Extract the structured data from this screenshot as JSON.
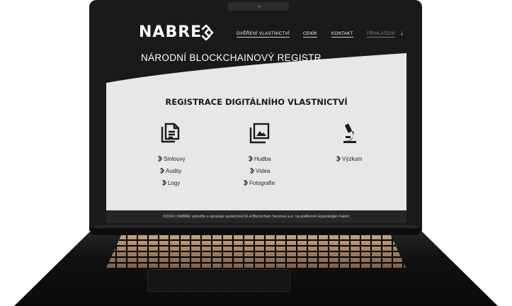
{
  "brand": {
    "logo_text": "NABRE",
    "registry_title": "NÁRODNÍ BLOCKCHAINOVÝ REGISTR"
  },
  "nav": {
    "items": [
      {
        "label": "OVĚŘENÍ VLASTNICTVÍ"
      },
      {
        "label": "CENÍK"
      },
      {
        "label": "KONTAKT"
      },
      {
        "label": "PŘIHLÁŠENÍ"
      }
    ],
    "login_arrow": "↓"
  },
  "main": {
    "title": "REGISTRACE DIGITÁLNÍHO VLASTNICTVÍ",
    "categories": [
      {
        "icon": "documents-icon",
        "items": [
          "Smlouvy",
          "Audity",
          "Logy"
        ]
      },
      {
        "icon": "images-icon",
        "items": [
          "Hudba",
          "Videa",
          "Fotografie"
        ]
      },
      {
        "icon": "microscope-icon",
        "items": [
          "Výzkum"
        ]
      }
    ]
  },
  "footer": {
    "text": "©2024 | NABRE vytvořila a spravuje společnost ELA Blockchain Services a.s. na platformě Hyperledger Fabric"
  },
  "colors": {
    "dark": "#1a1a1a",
    "light": "#e7e7e7"
  }
}
